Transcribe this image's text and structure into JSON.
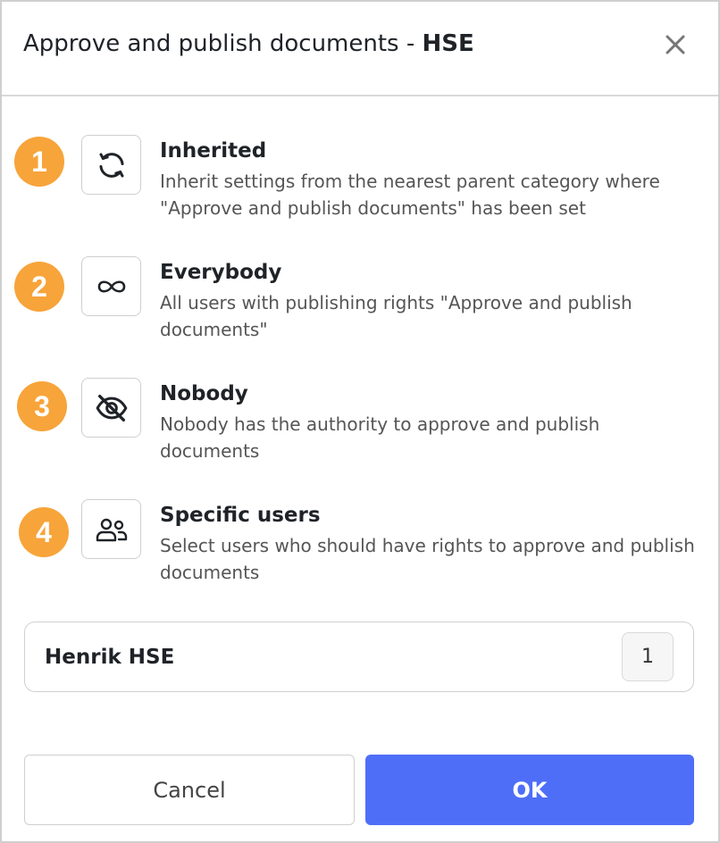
{
  "dialog": {
    "title_prefix": "Approve and publish documents - ",
    "title_suffix": "HSE"
  },
  "options": [
    {
      "number": "1",
      "icon": "sync-icon",
      "title": "Inherited",
      "description": "Inherit settings from the nearest parent category where \"Approve and publish documents\" has been set"
    },
    {
      "number": "2",
      "icon": "infinity-icon",
      "title": "Everybody",
      "description": "All users with publishing rights \"Approve and publish documents\""
    },
    {
      "number": "3",
      "icon": "eye-off-icon",
      "title": "Nobody",
      "description": "Nobody has the authority to approve and publish documents"
    },
    {
      "number": "4",
      "icon": "users-icon",
      "title": "Specific users",
      "description": "Select users who should have rights to approve and publish documents"
    }
  ],
  "selected_users": {
    "name": "Henrik HSE",
    "count": "1"
  },
  "buttons": {
    "cancel": "Cancel",
    "ok": "OK"
  },
  "colors": {
    "badge": "#f7a43a",
    "primary": "#4f6ef7"
  }
}
